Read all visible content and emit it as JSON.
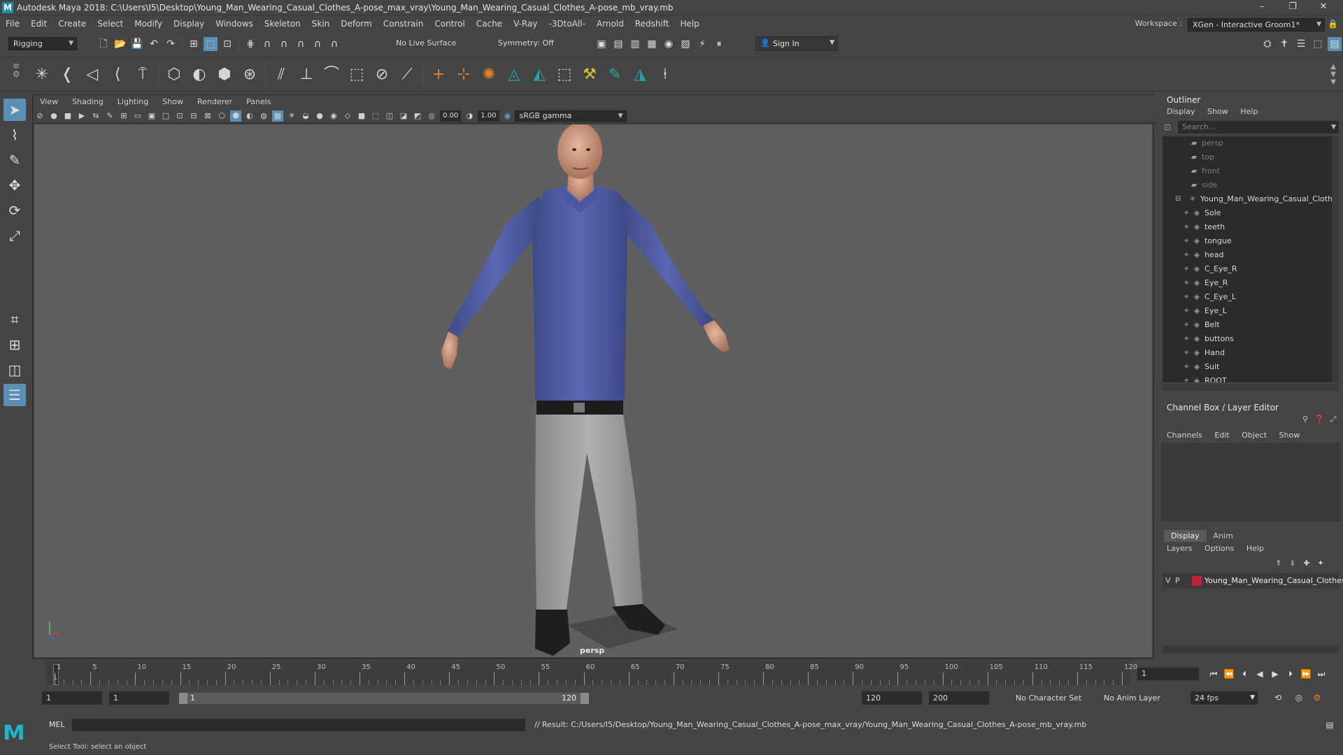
{
  "window": {
    "title": "Autodesk Maya 2018: C:\\Users\\I5\\Desktop\\Young_Man_Wearing_Casual_Clothes_A-pose_max_vray\\Young_Man_Wearing_Casual_Clothes_A-pose_mb_vray.mb",
    "logo": "M",
    "minimize": "–",
    "restore": "❐",
    "close": "✕"
  },
  "menubar": {
    "items": [
      "File",
      "Edit",
      "Create",
      "Select",
      "Modify",
      "Display",
      "Windows",
      "Skeleton",
      "Skin",
      "Deform",
      "Constrain",
      "Control",
      "Cache",
      "V-Ray",
      "-3DtoAll-",
      "Arnold",
      "Redshift",
      "Help"
    ],
    "workspace_label": "Workspace :",
    "workspace_value": "XGen - Interactive Groom1*"
  },
  "statusline": {
    "mode": "Rigging",
    "live_surface": "No Live Surface",
    "symmetry": "Symmetry: Off",
    "sign_in": "Sign In"
  },
  "viewport": {
    "menus": [
      "View",
      "Shading",
      "Lighting",
      "Show",
      "Renderer",
      "Panels"
    ],
    "exposure": "0.00",
    "gamma": "1.00",
    "color_space": "sRGB gamma",
    "camera_label": "persp"
  },
  "outliner": {
    "title": "Outliner",
    "menus": [
      "Display",
      "Show",
      "Help"
    ],
    "search_placeholder": "Search...",
    "cameras": [
      "persp",
      "top",
      "front",
      "side"
    ],
    "root": "Young_Man_Wearing_Casual_Clothes",
    "children": [
      "Sole",
      "teeth",
      "tongue",
      "head",
      "C_Eye_R",
      "Eye_R",
      "C_Eye_L",
      "Eye_L",
      "Belt",
      "buttons",
      "Hand",
      "Suit",
      "ROOT"
    ]
  },
  "channelbox": {
    "title": "Channel Box / Layer Editor",
    "menus": [
      "Channels",
      "Edit",
      "Object",
      "Show"
    ]
  },
  "layereditor": {
    "tabs": [
      "Display",
      "Anim"
    ],
    "menus": [
      "Layers",
      "Options",
      "Help"
    ],
    "layer": {
      "v": "V",
      "p": "P",
      "name": "Young_Man_Wearing_Casual_Clothes",
      "color": "#c0203a"
    }
  },
  "timeline": {
    "labels": [
      "1",
      "5",
      "10",
      "15",
      "20",
      "25",
      "30",
      "35",
      "40",
      "45",
      "50",
      "55",
      "60",
      "65",
      "70",
      "75",
      "80",
      "85",
      "90",
      "95",
      "100",
      "105",
      "110",
      "115",
      "120"
    ],
    "current_frame": "1"
  },
  "range": {
    "start": "1",
    "anim_start": "1",
    "range_start": "1",
    "range_end": "120",
    "end": "120",
    "anim_end": "200",
    "character_set": "No Character Set",
    "anim_layer": "No Anim Layer",
    "fps": "24 fps"
  },
  "cmdline": {
    "mode": "MEL",
    "result": "// Result: C:/Users/I5/Desktop/Young_Man_Wearing_Casual_Clothes_A-pose_max_vray/Young_Man_Wearing_Casual_Clothes_A-pose_mb_vray.mb",
    "help": "Select Tool: select an object"
  }
}
